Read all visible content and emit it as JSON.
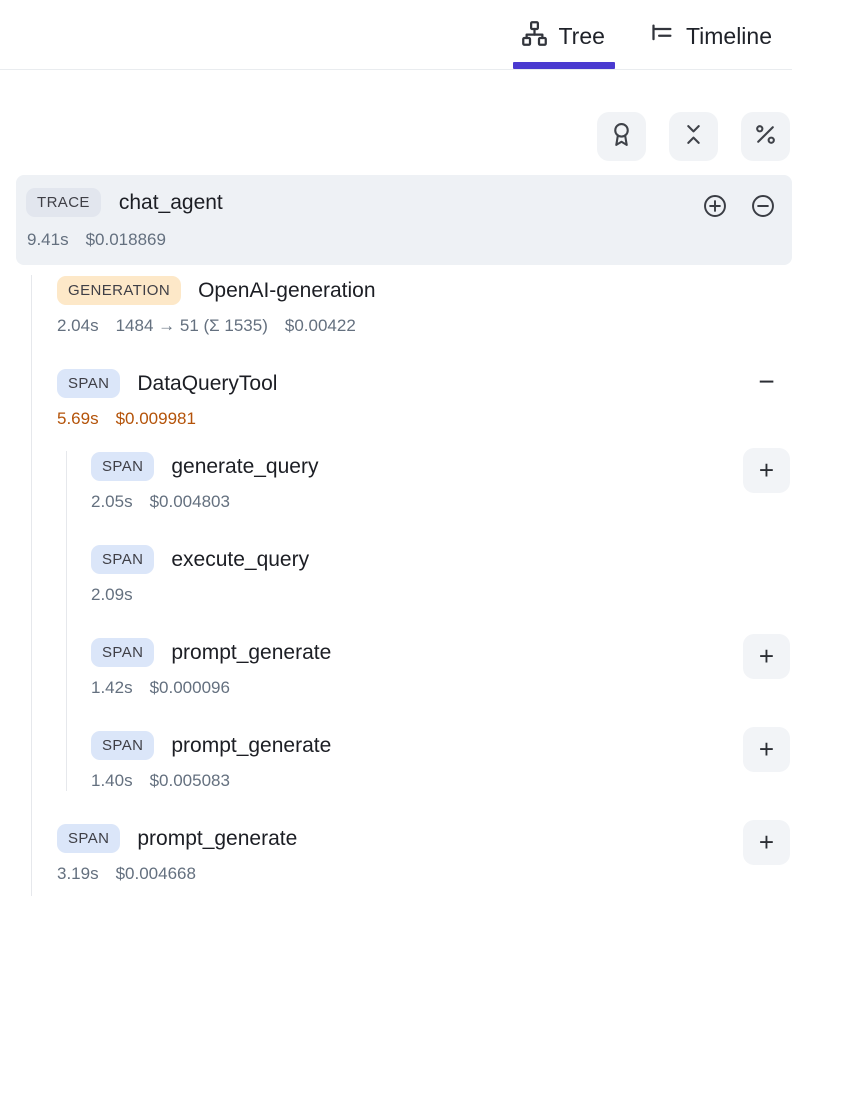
{
  "tabs": [
    {
      "label": "Tree",
      "icon": "network-icon",
      "active": true
    },
    {
      "label": "Timeline",
      "icon": "timeline-icon",
      "active": false
    }
  ],
  "toolbar": {
    "buttons": [
      {
        "name": "award-button",
        "icon": "award-icon"
      },
      {
        "name": "collapse-all-button",
        "icon": "chevrons-collapse-icon"
      },
      {
        "name": "percent-button",
        "icon": "percent-icon"
      }
    ]
  },
  "actions": {
    "expand_label": "+",
    "collapse_label": "−"
  },
  "tree": {
    "trace": {
      "badge": "TRACE",
      "title": "chat_agent",
      "metrics": [
        "9.41s",
        "$0.018869"
      ],
      "action_icons": [
        "plus-circle-icon",
        "minus-circle-icon"
      ]
    },
    "nodes": [
      {
        "badge": "GENERATION",
        "title": "OpenAI-generation",
        "metrics": [
          "2.04s",
          "1484 → 51 (Σ 1535)",
          "$0.00422"
        ],
        "level": 1
      },
      {
        "badge": "SPAN",
        "title": "DataQueryTool",
        "metrics": [
          "5.69s",
          "$0.009981"
        ],
        "level": 1,
        "metric_color": "#b45309",
        "action": "collapse"
      },
      {
        "badge": "SPAN",
        "title": "generate_query",
        "metrics": [
          "2.05s",
          "$0.004803"
        ],
        "level": 2,
        "action": "expand"
      },
      {
        "badge": "SPAN",
        "title": "execute_query",
        "metrics": [
          "2.09s"
        ],
        "level": 2
      },
      {
        "badge": "SPAN",
        "title": "prompt_generate",
        "metrics": [
          "1.42s",
          "$0.000096"
        ],
        "level": 2,
        "action": "expand"
      },
      {
        "badge": "SPAN",
        "title": "prompt_generate",
        "metrics": [
          "1.40s",
          "$0.005083"
        ],
        "level": 2,
        "action": "expand"
      },
      {
        "badge": "SPAN",
        "title": "prompt_generate",
        "metrics": [
          "3.19s",
          "$0.004668"
        ],
        "level": 1,
        "action": "expand"
      }
    ]
  },
  "colors": {
    "accent": "#4a3ad0",
    "amber_metric": "#b45309",
    "badge_trace_bg": "#e2e6ee",
    "badge_generation_bg": "#fde8c8",
    "badge_span_bg": "#dbe6f9",
    "selected_row_bg": "#eef1f5"
  }
}
